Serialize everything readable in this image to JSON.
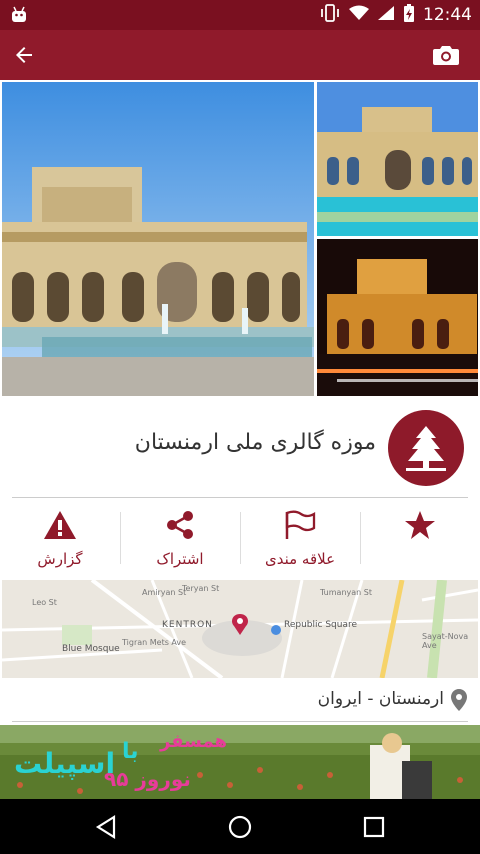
{
  "status_bar": {
    "time": "12:44",
    "icons": [
      "android-icon",
      "vibrate-icon",
      "wifi-icon",
      "signal-icon",
      "battery-charging-icon"
    ]
  },
  "app_bar": {
    "back_icon": "arrow-back-icon",
    "camera_icon": "camera-icon"
  },
  "place": {
    "title": "موزه گالری ملی ارمنستان",
    "icon": "pine-tree-icon"
  },
  "actions": [
    {
      "label": "گزارش",
      "icon": "warning-icon"
    },
    {
      "label": "اشتراک",
      "icon": "share-icon"
    },
    {
      "label": "علاقه مندی",
      "icon": "flag-icon"
    },
    {
      "label": "",
      "icon": "star-icon"
    }
  ],
  "map": {
    "labels": {
      "kentron": "KENTRON",
      "republic_square": "Republic Square",
      "blue_mosque": "Blue Mosque",
      "amiryan": "Amiryan St",
      "tigran": "Tigran Mets Ave",
      "tumanyan": "Tumanyan St",
      "teryan": "Teryan St",
      "leo": "Leo St",
      "sayat_nova": "Sayat-Nova Ave"
    }
  },
  "location": {
    "text": "ارمنستان - ایروان"
  },
  "banner": {
    "line_hamsafar": "همسفر",
    "line_ba": "با",
    "line_nowruz": "نوروز ۹۵",
    "line_espilet": "اسپیلت"
  },
  "colors": {
    "status_bar": "#7a1020",
    "app_bar": "#901a2b",
    "accent": "#901a2b"
  }
}
